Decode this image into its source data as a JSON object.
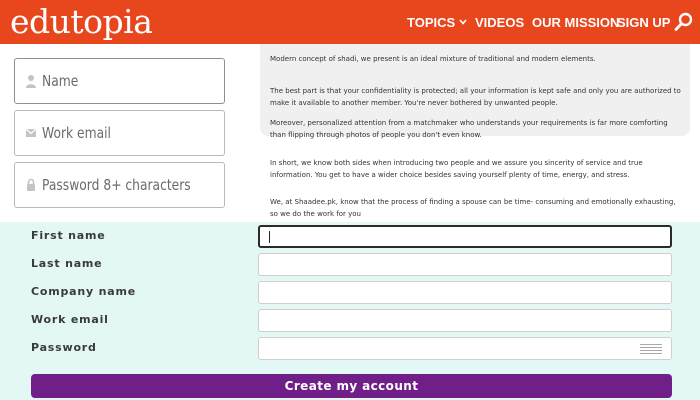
{
  "header": {
    "logo": "edutopia",
    "nav": [
      "TOPICS",
      "VIDEOS",
      "OUR MISSION",
      "SIGN UP"
    ],
    "background": "#e8461c"
  },
  "left_form": {
    "name_placeholder": "Name",
    "email_placeholder": "Work email",
    "password_placeholder": "Password 8+ characters"
  },
  "text_panel": {
    "paragraphs": [
      "Modern concept of shadi, we present is an ideal mixture of traditional and modern elements.",
      "The best part is that your confidentiality is protected; all your information is kept safe and only you are authorized to make it available to another member. You're never bothered by unwanted people.",
      "Moreover, personalized attention from a matchmaker who understands your requirements is far more comforting than flipping through photos of people you don't even know.",
      "In short, we know both sides when introducing two people and we assure you sincerity of service and true information. You get to have a wider choice besides saving yourself plenty of time, energy, and stress.",
      "We, at Shaadee.pk, know that the process of finding a spouse can be time- consuming and emotionally exhausting, so we do the work for you"
    ]
  },
  "signup": {
    "labels": [
      "First name",
      "Last name",
      "Company name",
      "Work email",
      "Password"
    ],
    "button": "Create my account",
    "background": "#e3f8f5",
    "button_color": "#6f1f87"
  }
}
